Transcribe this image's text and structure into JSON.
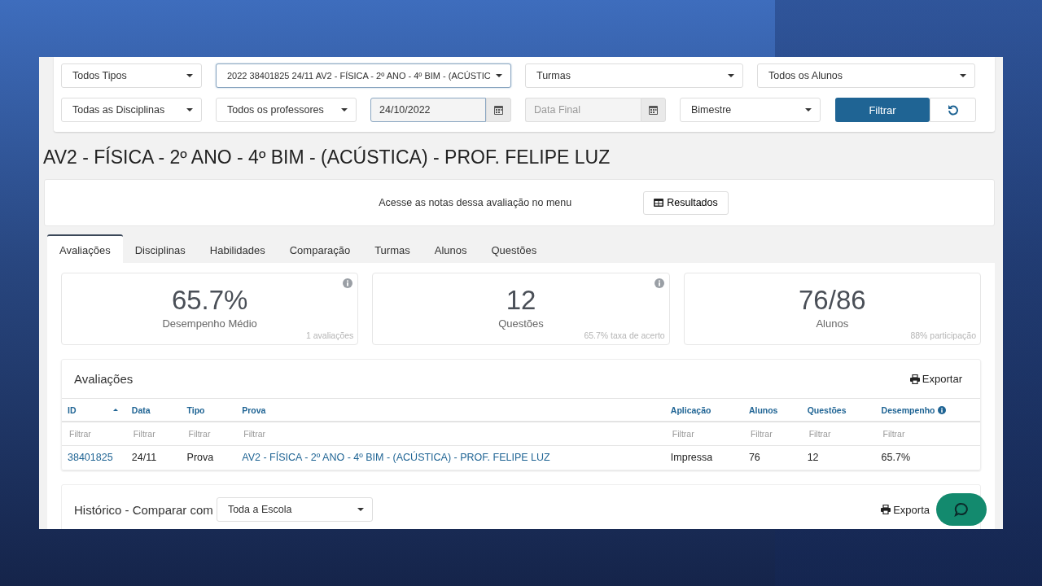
{
  "filters": [
    [
      {
        "kind": "select",
        "value": "Todos Tipos",
        "focused": false
      },
      {
        "kind": "select",
        "value": "2022 38401825 24/11 AV2 - FÍSICA - 2º ANO - 4º BIM - (ACÚSTIC",
        "focused": true
      },
      {
        "kind": "select",
        "value": "Turmas",
        "focused": false
      },
      {
        "kind": "select",
        "value": "Todos os Alunos",
        "focused": false
      }
    ],
    [
      {
        "kind": "select",
        "value": "Todas as Disciplinas",
        "focused": false
      },
      {
        "kind": "select",
        "value": "Todos os professores",
        "focused": false
      },
      {
        "kind": "date",
        "value": "24/10/2022",
        "focused": true
      },
      {
        "kind": "date",
        "placeholder": "Data Final",
        "focused": false
      },
      {
        "kind": "select",
        "value": "Bimestre",
        "focused": false
      },
      {
        "kind": "button",
        "label": "Filtrar"
      },
      {
        "kind": "reset"
      }
    ]
  ],
  "title": "AV2 - FÍSICA - 2º ANO - 4º BIM - (ACÚSTICA) - PROF. FELIPE LUZ",
  "notice": {
    "text": "Acesse as notas dessa avaliação no menu",
    "button": "Resultados"
  },
  "tabs": [
    {
      "label": "Avaliações",
      "selected": true
    },
    {
      "label": "Disciplinas",
      "selected": false
    },
    {
      "label": "Habilidades",
      "selected": false
    },
    {
      "label": "Comparação",
      "selected": false
    },
    {
      "label": "Turmas",
      "selected": false
    },
    {
      "label": "Alunos",
      "selected": false
    },
    {
      "label": "Questões",
      "selected": false
    }
  ],
  "stats": [
    {
      "value": "65.7%",
      "label": "Desempenho Médio",
      "note": "1 avaliações",
      "info": true
    },
    {
      "value": "12",
      "label": "Questões",
      "note": "65.7% taxa de acerto",
      "info": true
    },
    {
      "value": "76/86",
      "label": "Alunos",
      "note": "88% participação",
      "info": false
    }
  ],
  "table": {
    "title": "Avaliações",
    "export": "Exportar",
    "columns": [
      {
        "label": "ID",
        "sorted": true,
        "info": false
      },
      {
        "label": "Data",
        "sorted": false,
        "info": false
      },
      {
        "label": "Tipo",
        "sorted": false,
        "info": false
      },
      {
        "label": "Prova",
        "sorted": false,
        "info": false
      },
      {
        "label": "Aplicação",
        "sorted": false,
        "info": false
      },
      {
        "label": "Alunos",
        "sorted": false,
        "info": false
      },
      {
        "label": "Questões",
        "sorted": false,
        "info": false
      },
      {
        "label": "Desempenho",
        "sorted": false,
        "info": true
      }
    ],
    "filter_placeholders": [
      "Filtrar",
      "Filtrar",
      "Filtrar",
      "Filtrar",
      "Filtrar",
      "Filtrar",
      "Filtrar",
      "Filtrar"
    ],
    "rows": [
      [
        {
          "text": "38401825",
          "link": true
        },
        {
          "text": "24/11",
          "link": false
        },
        {
          "text": "Prova",
          "link": false
        },
        {
          "text": "AV2 - FÍSICA - 2º ANO - 4º BIM - (ACÚSTICA) - PROF. FELIPE LUZ",
          "link": true
        },
        {
          "text": "Impressa",
          "link": false
        },
        {
          "text": "76",
          "link": false
        },
        {
          "text": "12",
          "link": false
        },
        {
          "text": "65.7%",
          "link": false
        }
      ]
    ]
  },
  "history": {
    "title": "Histórico - Comparar com",
    "select": "Toda a Escola",
    "export": "Exporta"
  }
}
